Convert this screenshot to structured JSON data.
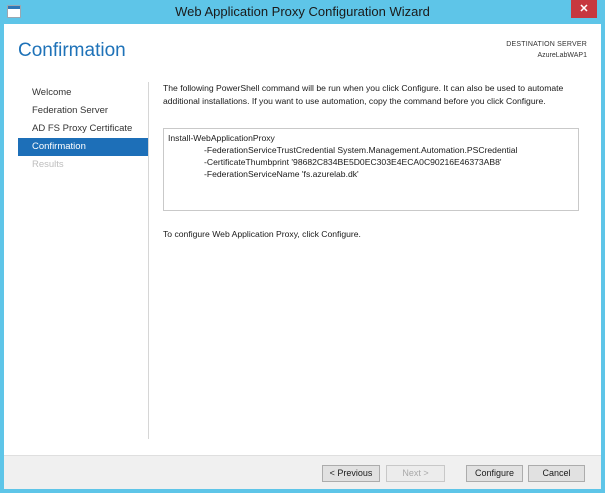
{
  "window": {
    "title": "Web Application Proxy Configuration Wizard",
    "close_glyph": "✕"
  },
  "header": {
    "page_title": "Confirmation",
    "destination_label": "DESTINATION SERVER",
    "destination_value": "AzureLabWAP1"
  },
  "nav": {
    "items": [
      {
        "label": "Welcome",
        "state": "normal"
      },
      {
        "label": "Federation Server",
        "state": "normal"
      },
      {
        "label": "AD FS Proxy Certificate",
        "state": "normal"
      },
      {
        "label": "Confirmation",
        "state": "active"
      },
      {
        "label": "Results",
        "state": "disabled"
      }
    ]
  },
  "content": {
    "intro": "The following PowerShell command will be run when you click Configure. It can also be used to automate additional installations. If you want to use automation, copy the command before you click Configure.",
    "command_lines": [
      "Install-WebApplicationProxy",
      "-FederationServiceTrustCredential System.Management.Automation.PSCredential",
      "-CertificateThumbprint '98682C834BE5D0EC303E4ECA0C90216E46373AB8'",
      "-FederationServiceName 'fs.azurelab.dk'"
    ],
    "instruction": "To configure Web Application Proxy, click Configure."
  },
  "buttons": {
    "previous": "< Previous",
    "next": "Next >",
    "configure": "Configure",
    "cancel": "Cancel"
  },
  "colors": {
    "frame": "#5ec5e8",
    "accent": "#1e72b8",
    "nav_active": "#1d6fb8",
    "close": "#c7383f"
  }
}
